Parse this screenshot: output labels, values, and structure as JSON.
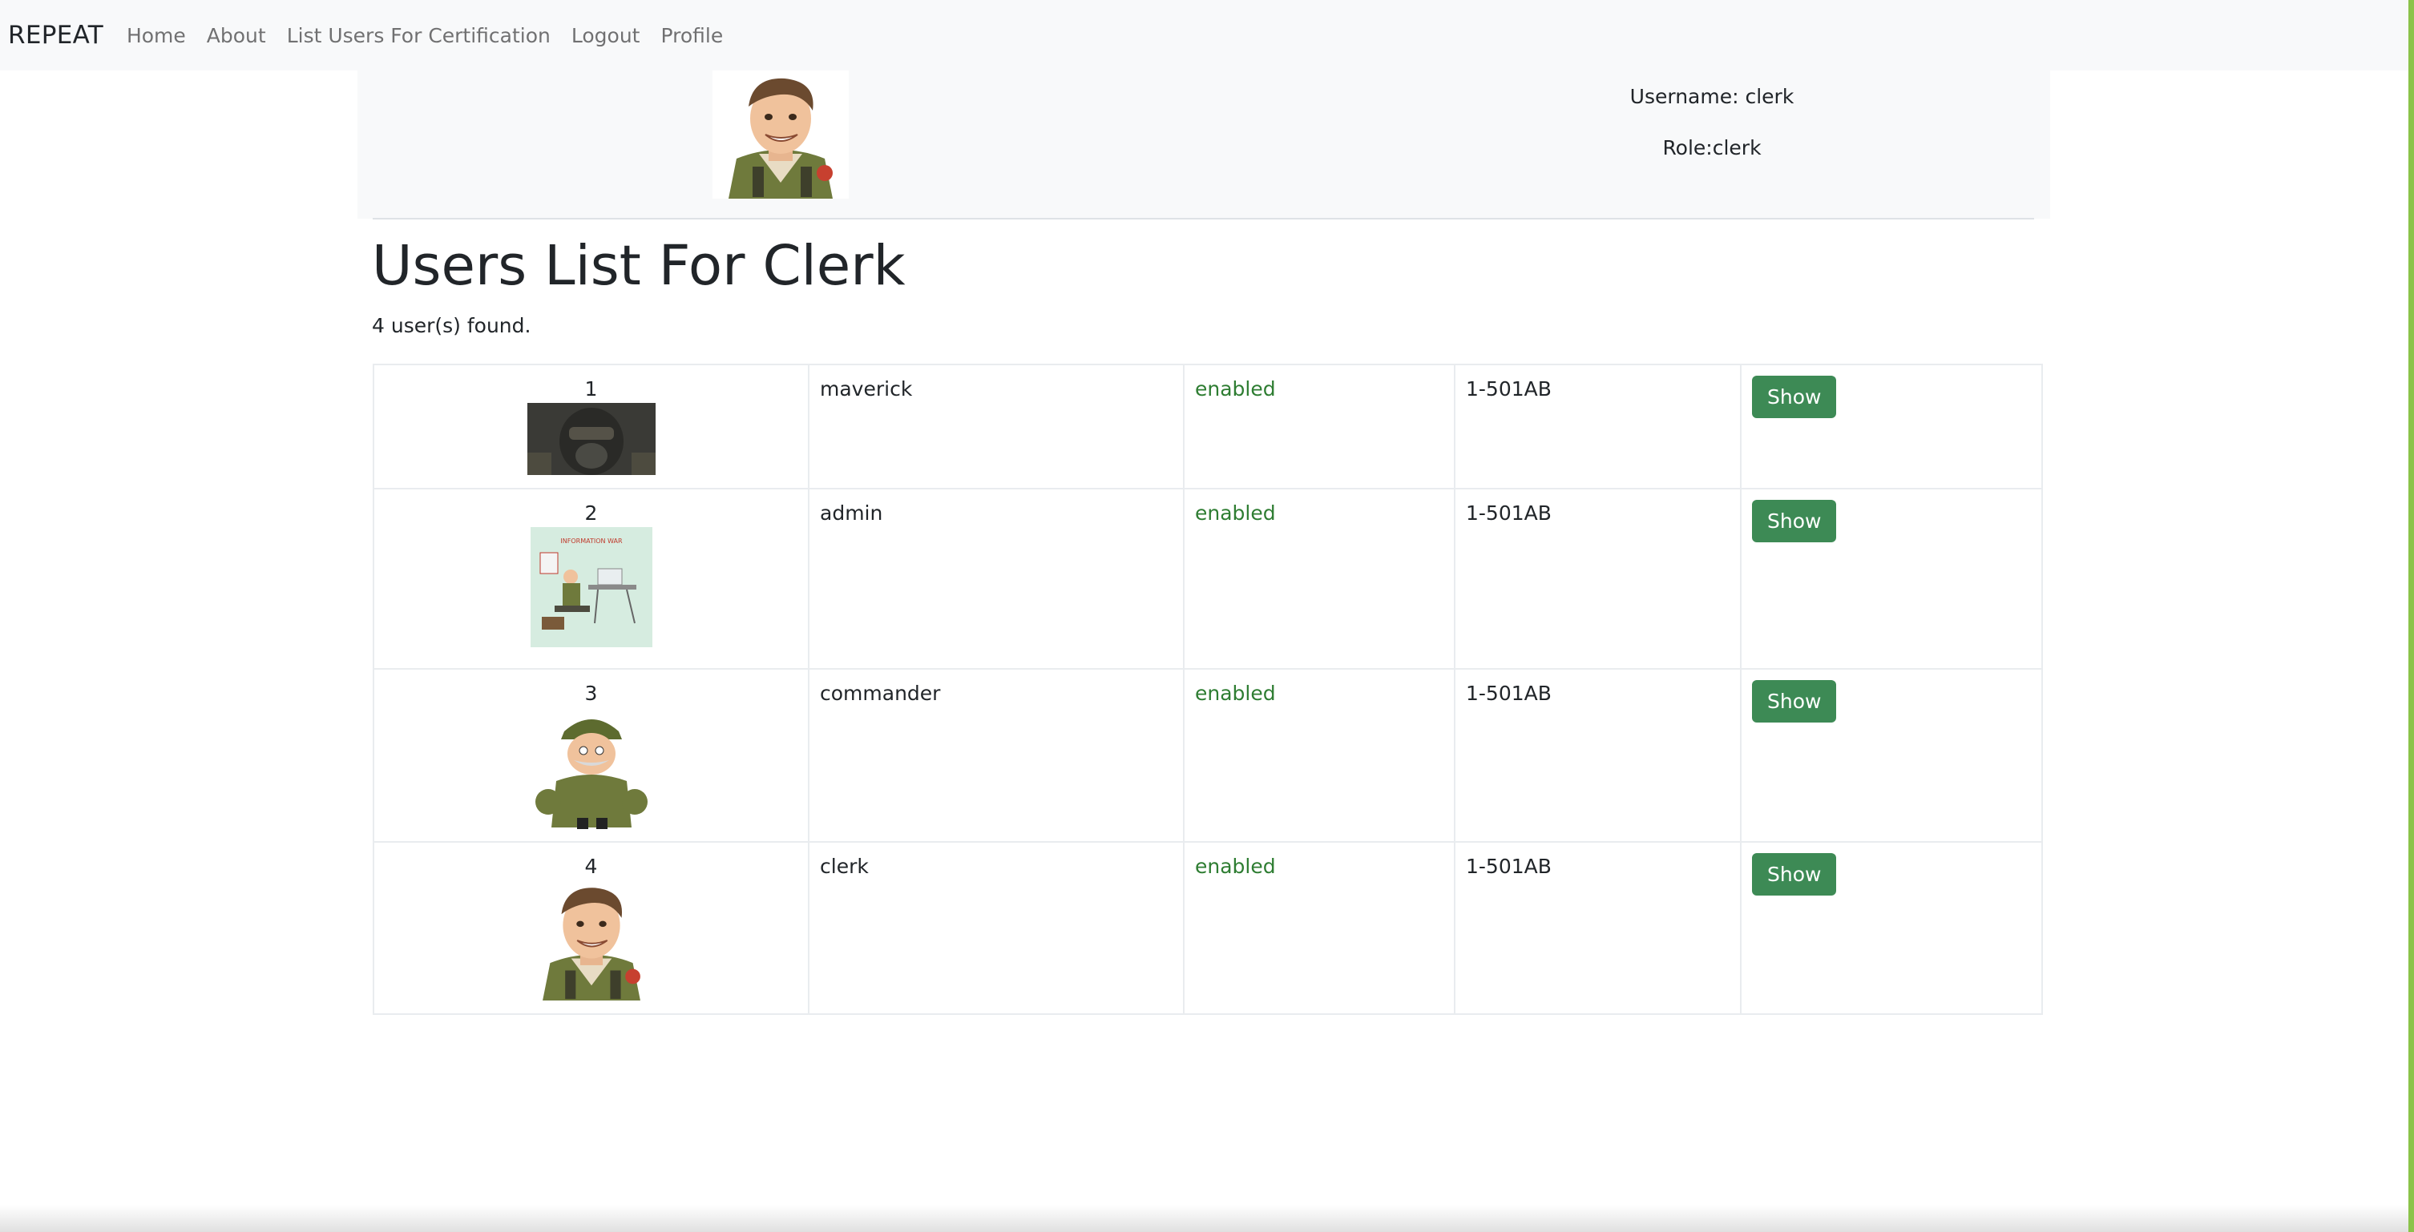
{
  "navbar": {
    "brand": "REPEAT",
    "links": [
      "Home",
      "About",
      "List Users For Certification",
      "Logout",
      "Profile"
    ]
  },
  "profile": {
    "avatar_icon": "soldier-avatar-icon",
    "username": "Username: clerk",
    "role": "Role:clerk"
  },
  "page": {
    "title": "Users List For Clerk",
    "count": "4 user(s) found."
  },
  "users": [
    {
      "index": "1",
      "username": "maverick",
      "status": "enabled",
      "code": "1-501AB",
      "action": "Show",
      "avatar_icon": "pilot-mask-avatar-icon"
    },
    {
      "index": "2",
      "username": "admin",
      "status": "enabled",
      "code": "1-501AB",
      "action": "Show",
      "avatar_icon": "desk-soldier-avatar-icon",
      "avatar_caption": "INFORMATION WAR"
    },
    {
      "index": "3",
      "username": "commander",
      "status": "enabled",
      "code": "1-501AB",
      "action": "Show",
      "avatar_icon": "commander-avatar-icon"
    },
    {
      "index": "4",
      "username": "clerk",
      "status": "enabled",
      "code": "1-501AB",
      "action": "Show",
      "avatar_icon": "soldier-avatar-icon"
    }
  ],
  "colors": {
    "navbar_bg": "#f8f9fa",
    "status_enabled": "#2e7d32",
    "button_bg": "#3d8a55",
    "accent_right": "#8bc34a"
  }
}
